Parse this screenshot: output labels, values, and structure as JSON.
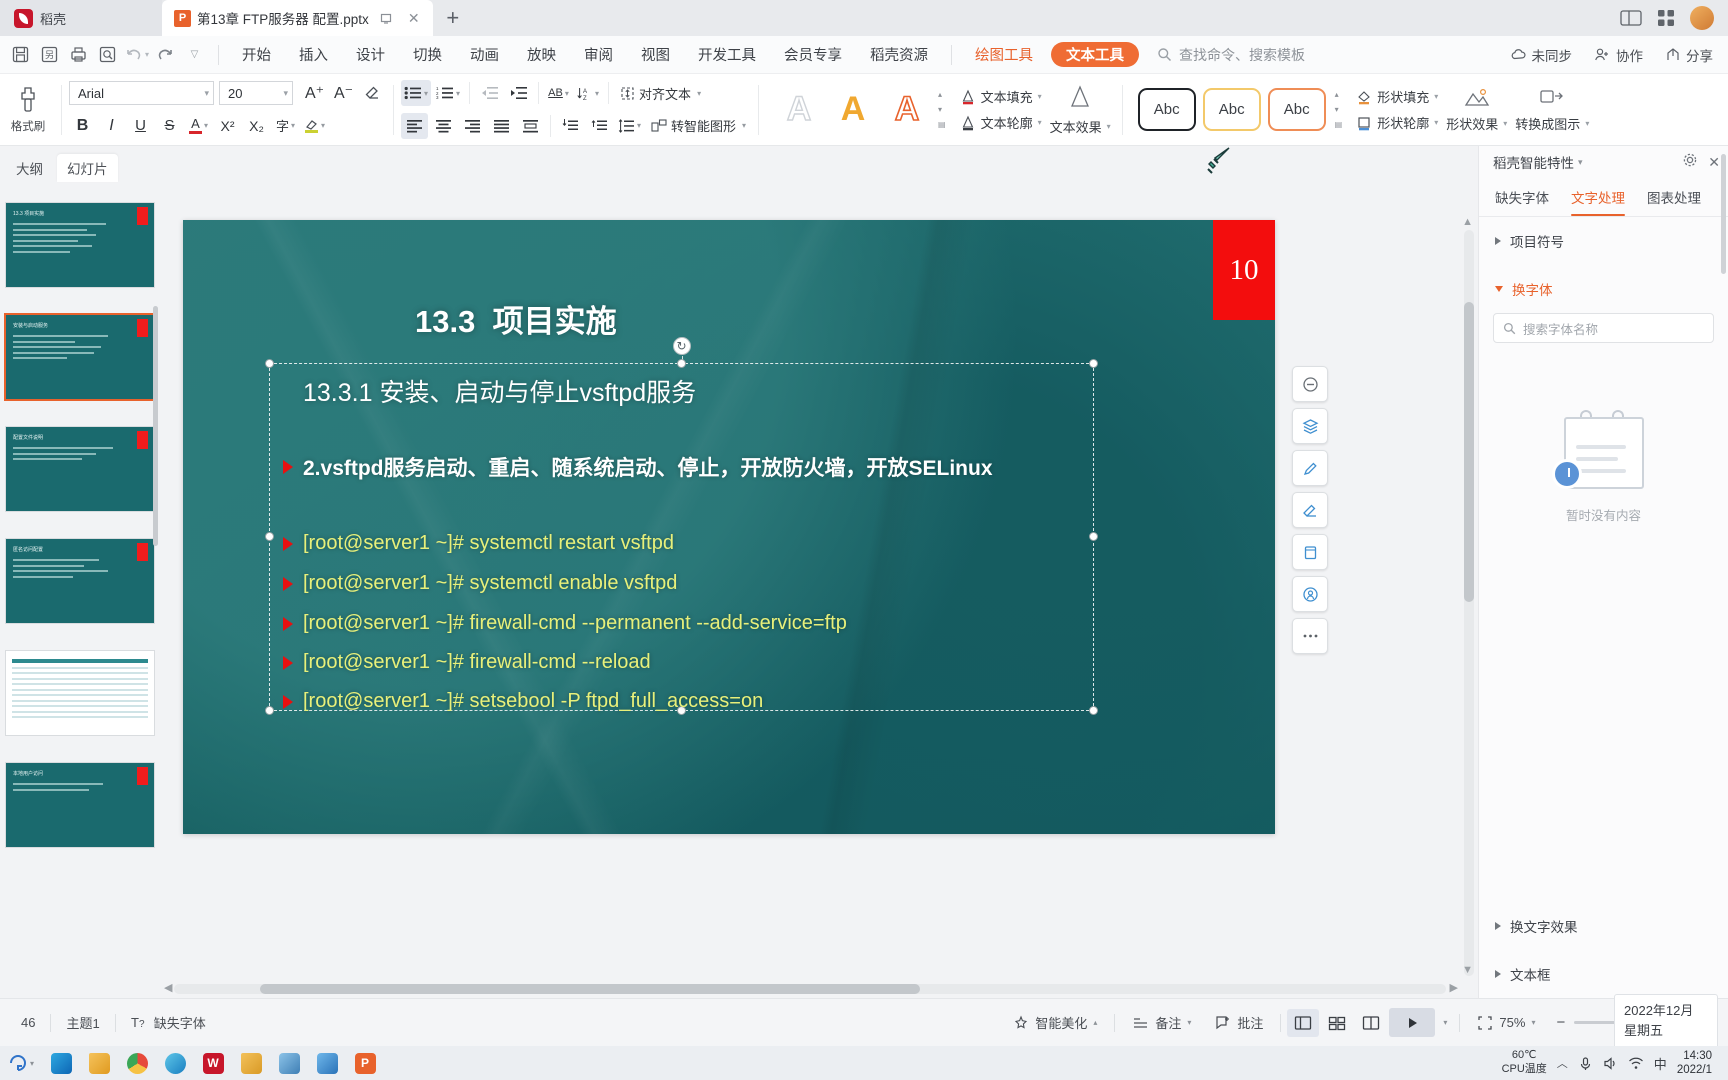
{
  "titlebar": {
    "home_label": "稻壳",
    "document_tab": "第13章 FTP服务器 配置.pptx",
    "new_tab": "+",
    "icons": {
      "ppt": "P",
      "restore": "🗖",
      "close": "✕",
      "panes": "▯▯",
      "grid": "▦"
    }
  },
  "menubar": {
    "quick": [
      "save-icon",
      "save-as-icon",
      "print-icon",
      "print-preview-icon",
      "undo-icon",
      "redo-icon",
      "customize-icon"
    ],
    "items": [
      "开始",
      "插入",
      "设计",
      "切换",
      "动画",
      "放映",
      "审阅",
      "视图",
      "开发工具",
      "会员专享",
      "稻壳资源"
    ],
    "context_tab": "绘图工具",
    "active_tab": "文本工具",
    "search_placeholder": "查找命令、搜索模板",
    "right_items": [
      "未同步",
      "协作",
      "分享"
    ]
  },
  "ribbon": {
    "format_painter": "格式刷",
    "font_name": "Arial",
    "font_size": "20",
    "grow_font": "A⁺",
    "shrink_font": "A⁻",
    "clear_format": "⌫",
    "bold": "B",
    "italic": "I",
    "underline": "U",
    "strike": "S",
    "font_color": "A",
    "superscript": "X²",
    "subscript": "X₂",
    "char_shade": "字",
    "highlight": "✎",
    "bullets": "≔",
    "numbering": "≕",
    "decrease_indent": "⇤",
    "increase_indent": "⇥",
    "align_left": "≡",
    "align_center": "≡",
    "align_right": "≡",
    "justify": "≡",
    "distribute": "≣",
    "line_spacing_a": "AB",
    "text_direction": "↓A",
    "align_text": "对齐文本",
    "to_smartart": "转智能图形",
    "space_before": "⇅",
    "space_after": "⇵",
    "line_space": "↕",
    "wordart_styles": [
      "A",
      "A",
      "A"
    ],
    "text_fill": "文本填充",
    "text_outline": "文本轮廓",
    "text_effects": "文本效果",
    "shape_presets": [
      "Abc",
      "Abc",
      "Abc"
    ],
    "shape_fill": "形状填充",
    "shape_outline": "形状轮廓",
    "shape_effects": "形状效果",
    "convert_to_pic": "转换成图示"
  },
  "left": {
    "tabs": [
      "大纲",
      "幻灯片"
    ],
    "active_tab": "幻灯片",
    "add_slide": "+",
    "thumbs": [
      {
        "title": "13.3 项目实施",
        "num": ""
      },
      {
        "title": "安装与启动服务",
        "num": ""
      },
      {
        "title": "配置文件说明",
        "num": ""
      },
      {
        "title": "匿名访问配置",
        "num": ""
      },
      {
        "title": "参数对照表",
        "num": ""
      },
      {
        "title": "本地用户访问",
        "num": ""
      }
    ]
  },
  "slide": {
    "page_number": "10",
    "title_num": "13.3",
    "title_text": "项目实施",
    "section": "13.3.1  安装、启动与停止vsftpd服务",
    "bullet": "2.vsftpd服务启动、重启、随系统启动、停止，开放防火墙，开放SELinux",
    "commands": [
      "[root@server1 ~]# systemctl restart vsftpd",
      "[root@server1 ~]# systemctl enable vsftpd",
      "[root@server1 ~]# firewall-cmd --permanent --add-service=ftp",
      "[root@server1 ~]# firewall-cmd --reload",
      "[root@server1 ~]# setsebool -P ftpd_full_access=on"
    ],
    "float_tools": [
      "minus-icon",
      "layers-icon",
      "pen-icon",
      "eraser-icon",
      "copy-icon",
      "locate-icon",
      "more-icon"
    ]
  },
  "right_panel": {
    "title": "稻壳智能特性",
    "gear": "⚙",
    "close": "✕",
    "tabs": [
      "缺失字体",
      "文字处理",
      "图表处理"
    ],
    "active_tab": "文字处理",
    "sections": [
      {
        "label": "项目符号",
        "open": false
      },
      {
        "label": "换字体",
        "open": true
      },
      {
        "label": "换文字效果",
        "open": false
      },
      {
        "label": "文本框",
        "open": false
      }
    ],
    "search_placeholder": "搜索字体名称",
    "empty_text": "暂时没有内容"
  },
  "statusbar": {
    "slide_count": "46",
    "theme": "主题1",
    "missing_font": "缺失字体",
    "beautify": "智能美化",
    "notes": "备注",
    "comments": "批注",
    "views": [
      "normal-view-icon",
      "sorter-view-icon",
      "reading-view-icon"
    ],
    "play": "▶",
    "fit_icon": "⛶",
    "zoom": "75%",
    "zoom_out": "−",
    "zoom_in": "+",
    "date_line1": "2022年12月",
    "date_line2": "星期五"
  },
  "taskbar": {
    "apps": [
      "start-icon",
      "edge-icon",
      "folder-icon",
      "chrome-icon",
      "ie-icon",
      "wps-icon",
      "explorer-icon",
      "media-icon",
      "notes-icon",
      "ppt-icon"
    ],
    "cpu_temp": "60℃",
    "cpu_label": "CPU温度",
    "time": "14:30",
    "date": "2022/1",
    "tray": [
      "up-arrow-icon",
      "mic-icon",
      "sound-icon",
      "network-icon"
    ],
    "ime": "中"
  },
  "colors": {
    "accent": "#e8622c",
    "slide_bg": "#176062",
    "page_badge": "#f30d0d",
    "cmd_text": "#e8f07a"
  }
}
